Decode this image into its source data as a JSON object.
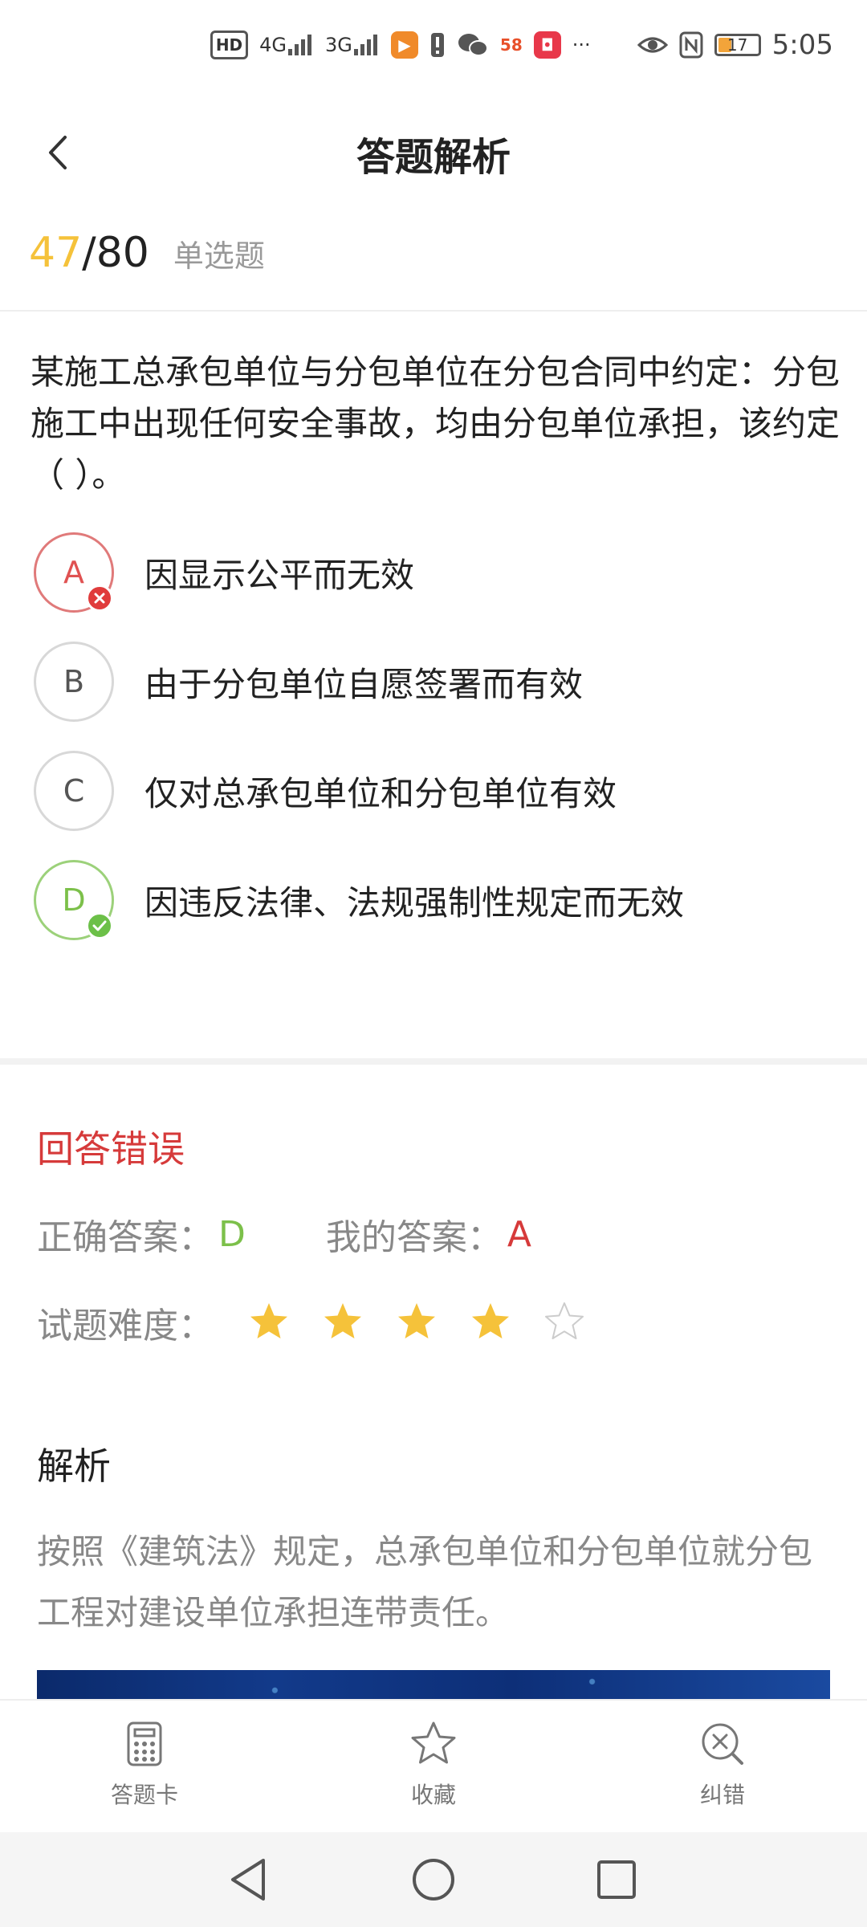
{
  "status_bar": {
    "hd_label": "HD",
    "sim1_label": "4G",
    "sim2_label": "3G",
    "badge_58": "58",
    "more": "···",
    "battery_level": "17",
    "time": "5:05"
  },
  "header": {
    "title": "答题解析"
  },
  "progress": {
    "current": "47",
    "separator": "/",
    "total": "80",
    "question_type": "单选题"
  },
  "question": {
    "text": "某施工总承包单位与分包单位在分包合同中约定：分包施工中出现任何安全事故，均由分包单位承担，该约定（ ）。",
    "options": [
      {
        "letter": "A",
        "text": "因显示公平而无效",
        "state": "wrong"
      },
      {
        "letter": "B",
        "text": "由于分包单位自愿签署而有效",
        "state": "normal"
      },
      {
        "letter": "C",
        "text": "仅对总承包单位和分包单位有效",
        "state": "normal"
      },
      {
        "letter": "D",
        "text": "因违反法律、法规强制性规定而无效",
        "state": "correct"
      }
    ]
  },
  "result": {
    "title": "回答错误",
    "correct_label": "正确答案：",
    "correct_value": "D",
    "mine_label": "我的答案：",
    "mine_value": "A",
    "difficulty_label": "试题难度：",
    "difficulty_stars": 4,
    "difficulty_max": 5
  },
  "analysis": {
    "title": "解析",
    "text": "按照《建筑法》规定，总承包单位和分包单位就分包工程对建设单位承担连带责任。"
  },
  "tabs": [
    {
      "label": "答题卡",
      "icon": "answer-card-icon"
    },
    {
      "label": "收藏",
      "icon": "star-outline-icon"
    },
    {
      "label": "纠错",
      "icon": "error-correct-icon"
    }
  ],
  "colors": {
    "accent_yellow": "#f5c23a",
    "wrong_red": "#d63a3a",
    "correct_green": "#7cc04a",
    "muted_gray": "#888888"
  }
}
